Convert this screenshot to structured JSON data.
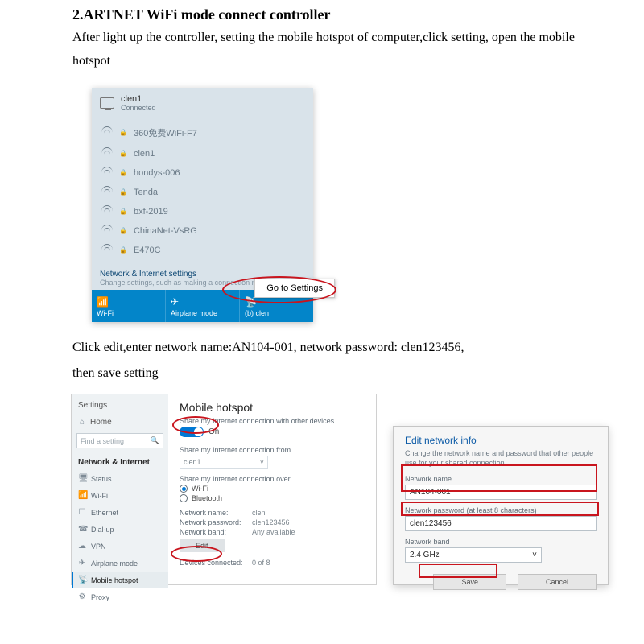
{
  "heading": "2.ARTNET WiFi mode connect controller",
  "intro": "After light up the controller, setting the mobile hotspot of computer,click setting, open the mobile hotspot",
  "wifi_flyout": {
    "connected": {
      "name": "clen1",
      "status": "Connected"
    },
    "networks": [
      "360免费WiFi-F7",
      "clen1",
      "hondys-006",
      "Tenda",
      "bxf-2019",
      "ChinaNet-VsRG",
      "E470C"
    ],
    "settings_title": "Network & Internet settings",
    "settings_sub": "Change settings, such as making a connection metered.",
    "btn_wifi": "Wi-Fi",
    "btn_airplane": "Airplane mode",
    "btn_hotspot_pre": "(b)",
    "btn_hotspot": "clen",
    "go_to_settings": "Go to Settings"
  },
  "mid_text1": "Click edit,enter network name:AN104-001, network password: clen123456,",
  "mid_text2": "then save setting",
  "settings": {
    "app": "Settings",
    "home": "Home",
    "search_placeholder": "Find a setting",
    "category": "Network & Internet",
    "items": [
      "Status",
      "Wi-Fi",
      "Ethernet",
      "Dial-up",
      "VPN",
      "Airplane mode",
      "Mobile hotspot",
      "Proxy"
    ],
    "content": {
      "title": "Mobile hotspot",
      "share_lbl": "Share my Internet connection with other devices",
      "on": "On",
      "share_from": "Share my Internet connection from",
      "from_val": "clen1",
      "share_over": "Share my Internet connection over",
      "r_wifi": "Wi-Fi",
      "r_bt": "Bluetooth",
      "name_lbl": "Network name:",
      "name_val": "clen",
      "pw_lbl": "Network password:",
      "pw_val": "clen123456",
      "band_lbl": "Network band:",
      "band_val": "Any available",
      "edit": "Edit",
      "devices_lbl": "Devices connected:",
      "devices_val": "0 of 8"
    }
  },
  "dialog": {
    "title": "Edit network info",
    "sub": "Change the network name and password that other people use for your shared connection.",
    "name_lbl": "Network name",
    "name_val": "AN104-001",
    "pw_lbl": "Network password (at least 8 characters)",
    "pw_val": "clen123456",
    "band_lbl": "Network band",
    "band_val": "2.4 GHz",
    "save": "Save",
    "cancel": "Cancel"
  }
}
